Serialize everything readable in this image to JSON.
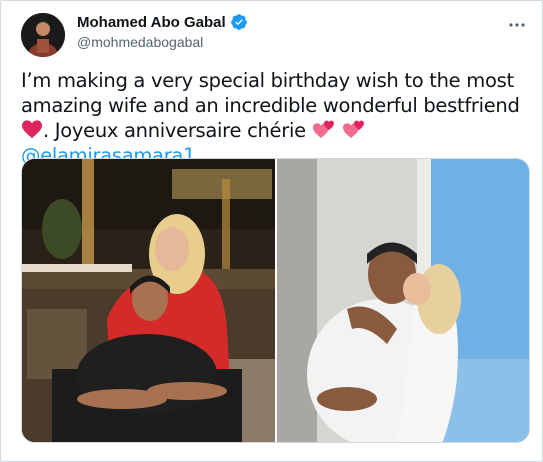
{
  "author": {
    "display_name": "Mohamed Abo Gabal",
    "handle": "@mohmedabogabal",
    "verified": true
  },
  "tweet": {
    "text_main": "I’m making a very special birthday wish to the most amazing wife and an incredible wonderful bestfriend",
    "text_after_heart": ". Joyeux anniversaire chérie",
    "mention": "@elamirasamara1"
  },
  "media": {
    "photos": [
      {
        "description_icon": "photo-couple-restaurant"
      },
      {
        "description_icon": "photo-couple-hug-balcony"
      }
    ]
  },
  "colors": {
    "link": "#1d9bf0",
    "verified": "#1d9bf0",
    "text": "#0f1419",
    "secondary": "#536471",
    "heart": "#e0245e"
  },
  "icons": {
    "verified": "verified-badge-icon",
    "more": "more-options-icon",
    "heart": "red-heart-icon",
    "two_hearts": "two-hearts-icon"
  }
}
